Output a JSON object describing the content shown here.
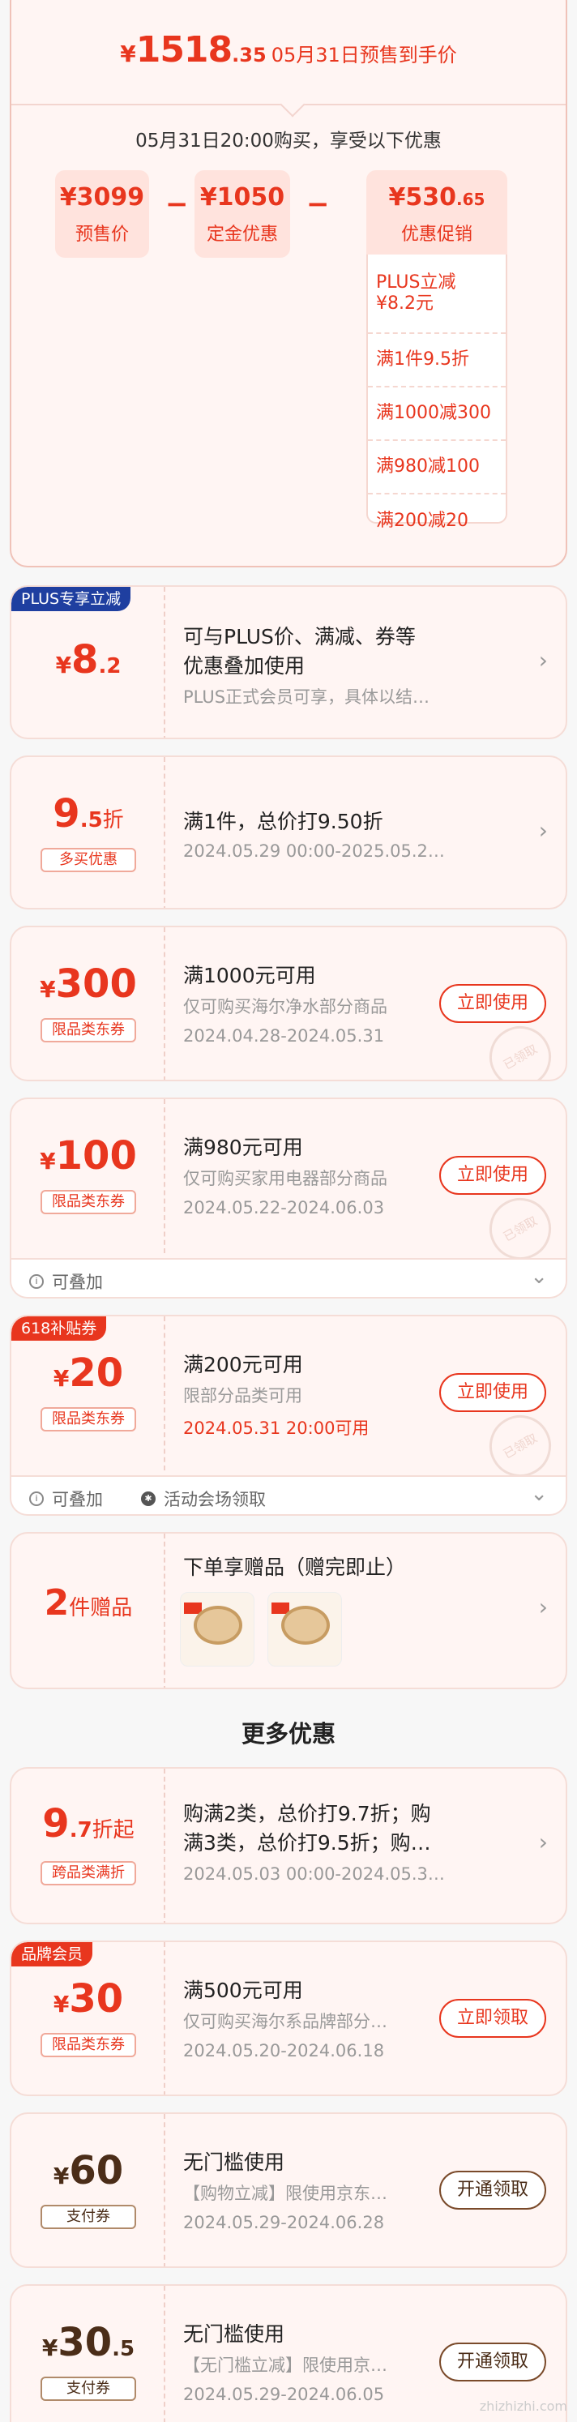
{
  "summary": {
    "currency": "¥",
    "price_int": "1518",
    "price_dec": ".35",
    "price_text": "05月31日预售到手价",
    "subtitle": "05月31日20:00购买，享受以下优惠",
    "boxes": [
      {
        "value": "¥3099",
        "value_small": "",
        "label": "预售价"
      },
      {
        "value": "¥1050",
        "value_small": "",
        "label": "定金优惠"
      },
      {
        "value": "¥530",
        "value_small": ".65",
        "label": "优惠促销"
      }
    ],
    "minus": "−",
    "promos": [
      "PLUS立减 ¥8.2元",
      "满1件9.5折",
      "满1000减300",
      "满980减100",
      "满200减20"
    ]
  },
  "coupons": {
    "plus": {
      "badge": "PLUS专享立减",
      "cur": "¥",
      "num": "8",
      "frac": ".2",
      "title": "可与PLUS价、满减、券等优惠叠加使用",
      "title_l1": "可与PLUS价、满减、券等",
      "title_l2": "优惠叠加使用",
      "desc": "PLUS正式会员可享，具体以结…"
    },
    "discount": {
      "num": "9",
      "frac": ".5",
      "unit": "折",
      "tag": "多买优惠",
      "title": "满1件，总价打9.50折",
      "date": "2024.05.29 00:00-2025.05.2…"
    },
    "c300": {
      "cur": "¥",
      "num": "300",
      "tag": "限品类东券",
      "title": "满1000元可用",
      "desc": "仅可购买海尔净水部分商品",
      "date": "2024.04.28-2024.05.31",
      "btn": "立即使用"
    },
    "c100": {
      "cur": "¥",
      "num": "100",
      "tag": "限品类东券",
      "title": "满980元可用",
      "desc": "仅可购买家用电器部分商品",
      "date": "2024.05.22-2024.06.03",
      "btn": "立即使用",
      "foot": "可叠加"
    },
    "c20": {
      "badge": "618补贴券",
      "cur": "¥",
      "num": "20",
      "tag": "限品类东券",
      "title": "满200元可用",
      "desc": "限部分品类可用",
      "date": "2024.05.31 20:00可用",
      "btn": "立即使用",
      "foot1": "可叠加",
      "foot2": "活动会场领取"
    },
    "gift": {
      "num": "2",
      "unit": "件赠品",
      "title": "下单享赠品（赠完即止）",
      "img_caption": "赠品"
    },
    "stamp": "已领取"
  },
  "more": {
    "title": "更多优惠",
    "cross": {
      "num": "9",
      "frac": ".7",
      "unit": "折起",
      "tag": "跨品类满折",
      "title_l1": "购满2类，总价打9.7折；购",
      "title_l2": "满3类，总价打9.5折；购…",
      "date": "2024.05.03 00:00-2024.05.3…"
    },
    "c30": {
      "badge": "品牌会员",
      "cur": "¥",
      "num": "30",
      "tag": "限品类东券",
      "title": "满500元可用",
      "desc": "仅可购买海尔系品牌部分…",
      "date": "2024.05.20-2024.06.18",
      "btn": "立即领取"
    },
    "c60": {
      "cur": "¥",
      "num": "60",
      "tag": "支付券",
      "title": "无门槛使用",
      "desc": "【购物立减】限使用京东…",
      "date": "2024.05.29-2024.06.28",
      "btn": "开通领取"
    },
    "c305": {
      "cur": "¥",
      "num": "30",
      "frac": ".5",
      "tag": "支付券",
      "title": "无门槛使用",
      "desc": "【无门槛立减】限使用京…",
      "date": "2024.05.29-2024.06.05",
      "btn": "开通领取"
    }
  },
  "watermark": "zhizhizhi.com"
}
